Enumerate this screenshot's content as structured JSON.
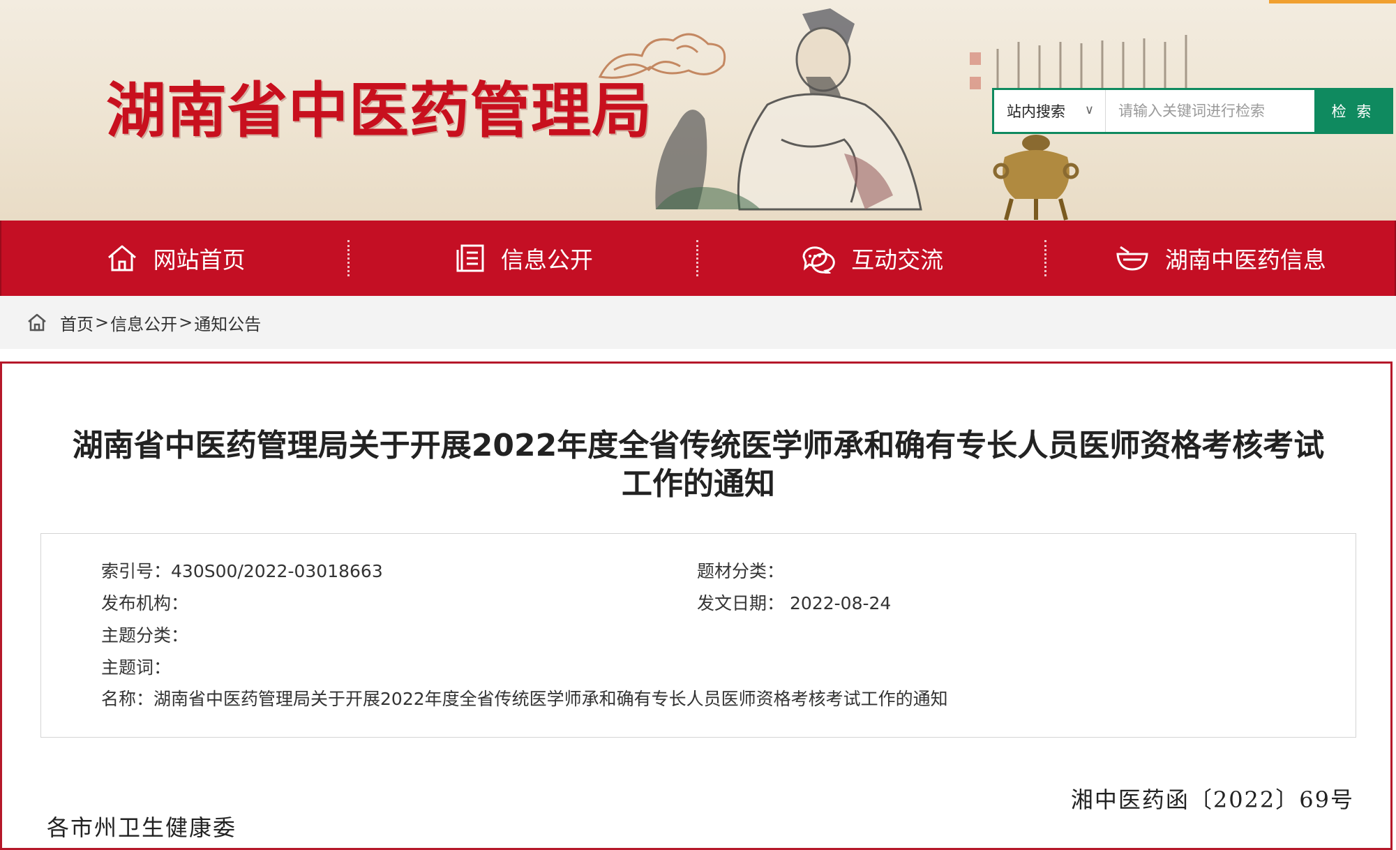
{
  "header": {
    "site_title": "湖南省中医药管理局",
    "search": {
      "scope_label": "站内搜索",
      "placeholder": "请输入关键词进行检索",
      "button_label": "检 索"
    }
  },
  "nav": {
    "items": [
      {
        "label": "网站首页",
        "icon": "home-icon"
      },
      {
        "label": "信息公开",
        "icon": "document-icon"
      },
      {
        "label": "互动交流",
        "icon": "chat-bubbles-icon"
      },
      {
        "label": "湖南中医药信息",
        "icon": "herb-bowl-icon"
      }
    ]
  },
  "breadcrumb": {
    "items": [
      "首页",
      "信息公开",
      "通知公告"
    ],
    "separator": ">"
  },
  "article": {
    "title_line1": "湖南省中医药管理局关于开展2022年度全省传统医学师承和确有专长人员医师资格考核考试",
    "title_line2": "工作的通知",
    "meta": {
      "index_label": "索引号：",
      "index_value": "430S00/2022-03018663",
      "category_label": "题材分类：",
      "category_value": "",
      "publisher_label": "发布机构：",
      "publisher_value": "",
      "date_label": "发文日期：",
      "date_value": "2022-08-24",
      "subject_label": "主题分类：",
      "subject_value": "",
      "keywords_label": "主题词：",
      "keywords_value": "",
      "name_label": "名称：",
      "name_value": "湖南省中医药管理局关于开展2022年度全省传统医学师承和确有专长人员医师资格考核考试工作的通知"
    },
    "doc_number": "湘中医药函〔2022〕69号",
    "recipient_partial": "各市州卫生健康委"
  },
  "colors": {
    "brand_red": "#c40f24",
    "search_green": "#0f8a5f",
    "accent_orange": "#f0a030"
  }
}
